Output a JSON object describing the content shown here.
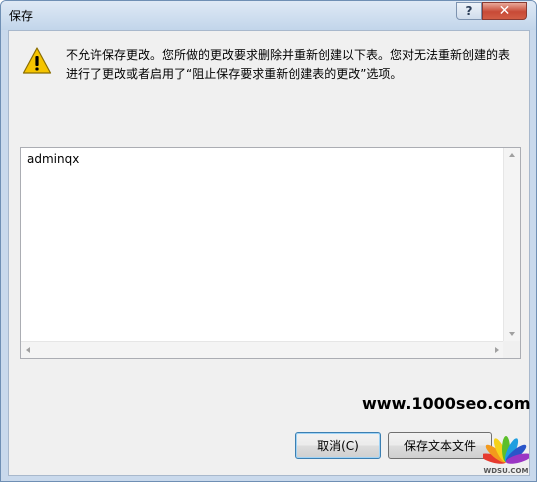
{
  "window": {
    "title": "保存",
    "help_label": "?",
    "close_label": "✕"
  },
  "message": {
    "icon": "warning-icon",
    "text": "不允许保存更改。您所做的更改要求删除并重新创建以下表。您对无法重新创建的表进行了更改或者启用了“阻止保存要求重新创建表的更改”选项。"
  },
  "list": {
    "items": [
      "adminqx"
    ]
  },
  "buttons": {
    "cancel_label": "取消(C)",
    "save_text_label": "保存文本文件"
  },
  "watermark": {
    "url": "www.1000seo.com",
    "logo_text": "WDSU.COM"
  },
  "colors": {
    "close_button": "#c84a36",
    "titlebar": "#c9d9ec",
    "dialog_bg": "#f0f0f0",
    "warning_yellow": "#f5c400"
  }
}
